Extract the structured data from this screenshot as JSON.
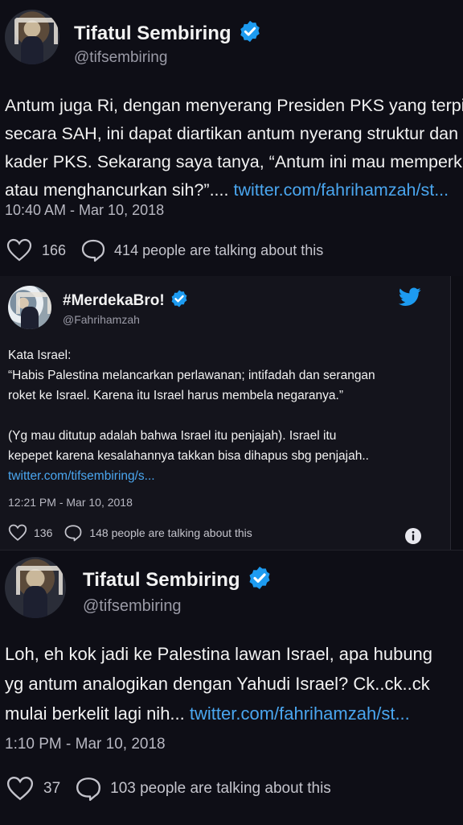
{
  "tweet1": {
    "name": "Tifatul Sembiring",
    "handle": "@tifsembiring",
    "lines": [
      "Antum juga Ri, dengan menyerang Presiden PKS yang terpi",
      "secara SAH, ini dapat diartikan antum nyerang struktur dan",
      "kader PKS. Sekarang saya tanya, “Antum ini mau memperku",
      "atau menghancurkan sih?”...."
    ],
    "link": "twitter.com/fahrihamzah/st...",
    "time": "10:40 AM - Mar 10, 2018",
    "likes": "166",
    "talking": "414 people are talking about this"
  },
  "tweet2": {
    "name": "#MerdekaBro!",
    "handle": "@Fahrihamzah",
    "lines": [
      "Kata Israel:",
      "“Habis Palestina melancarkan perlawanan; intifadah dan serangan",
      "roket ke Israel. Karena itu Israel harus membela negaranya.”",
      "(Yg mau ditutup adalah bahwa Israel itu penjajah). Israel itu",
      "kepepet karena kesalahannya takkan bisa dihapus sbg penjajah.."
    ],
    "link": "twitter.com/tifsembiring/s...",
    "time": "12:21 PM - Mar 10, 2018",
    "likes": "136",
    "talking": "148 people are talking about this"
  },
  "tweet3": {
    "name": "Tifatul Sembiring",
    "handle": "@tifsembiring",
    "lines": [
      "Loh, eh kok jadi ke Palestina lawan Israel, apa hubung",
      "yg antum analogikan dengan Yahudi Israel? Ck..ck..ck",
      "mulai berkelit lagi nih..."
    ],
    "link": "twitter.com/fahrihamzah/st...",
    "time": "1:10 PM - Mar 10, 2018",
    "likes": "37",
    "talking": "103 people are talking about this"
  },
  "colors": {
    "link": "#4aa6ef",
    "verified": "#1d9bf0",
    "background": "#0e0e16"
  },
  "icons": [
    "verified-icon",
    "heart-icon",
    "comment-icon",
    "twitter-bird-icon",
    "info-icon"
  ]
}
